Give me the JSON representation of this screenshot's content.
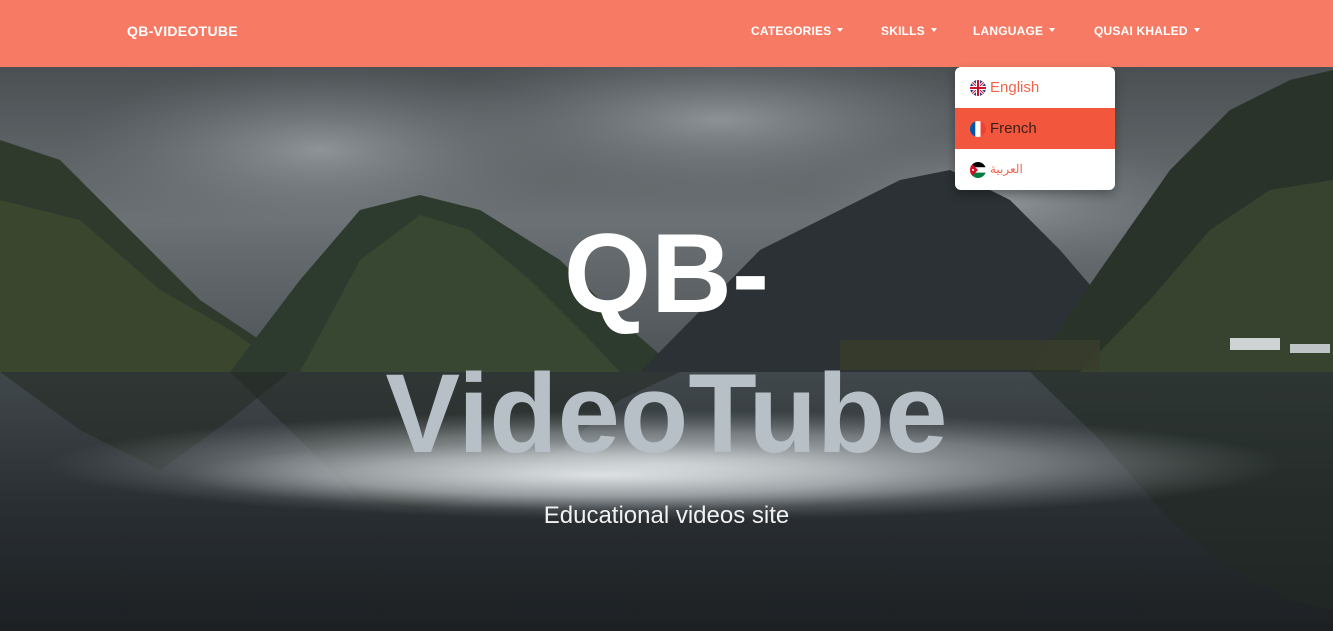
{
  "navbar": {
    "brand": "QB-VIDEOTUBE",
    "items": [
      {
        "label": "CATEGORIES"
      },
      {
        "label": "SKILLS"
      },
      {
        "label": "LANGUAGE"
      },
      {
        "label": "QUSAI KHALED"
      }
    ]
  },
  "language_menu": {
    "expanded": true,
    "active": "French",
    "items": [
      {
        "label": "English",
        "icon": "uk-flag-icon"
      },
      {
        "label": "French",
        "icon": "france-flag-icon"
      },
      {
        "label": "العربية",
        "icon": "jordan-flag-icon"
      }
    ]
  },
  "hero": {
    "title_line1": "QB-",
    "title_line2": "VideoTube",
    "subtitle": "Educational videos site"
  },
  "colors": {
    "navbar_bg": "#f77b64",
    "dropdown_active_bg": "#f2573e",
    "dropdown_link": "#f2634b"
  }
}
